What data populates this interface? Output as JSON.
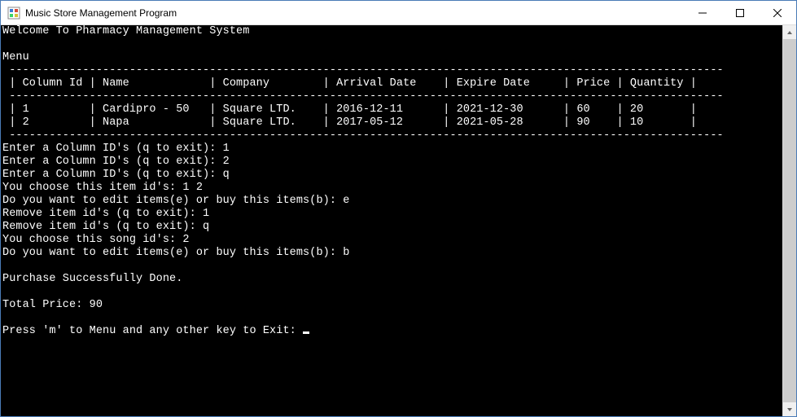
{
  "window": {
    "title": "Music Store Management Program"
  },
  "console": {
    "welcome": "Welcome To Pharmacy Management System",
    "menuLabel": "Menu",
    "columns": [
      "Column Id",
      "Name",
      "Company",
      "Arrival Date",
      "Expire Date",
      "Price",
      "Quantity"
    ],
    "rows": [
      {
        "id": "1",
        "name": "Cardipro - 50",
        "company": "Square LTD.",
        "arrival": "2016-12-11",
        "expire": "2021-12-30",
        "price": "60",
        "qty": "20"
      },
      {
        "id": "2",
        "name": "Napa",
        "company": "Square LTD.",
        "arrival": "2017-05-12",
        "expire": "2021-05-28",
        "price": "90",
        "qty": "10"
      }
    ],
    "prompts": {
      "enterId": "Enter a Column ID's (q to exit): ",
      "youChooseItems": "You choose this item id's: ",
      "editOrBuy": "Do you want to edit items(e) or buy this items(b): ",
      "removeId": "Remove item id's (q to exit): ",
      "youChooseSongs": "You choose this song id's: ",
      "purchaseDone": "Purchase Successfully Done.",
      "totalPriceLabel": "Total Price: ",
      "pressM": "Press 'm' to Menu and any other key to Exit: "
    },
    "inputs": {
      "enter1": "1",
      "enter2": "2",
      "enter3": "q",
      "chosenItems": "1 2",
      "editOrBuy1": "e",
      "remove1": "1",
      "remove2": "q",
      "chosenSongs": "2",
      "editOrBuy2": "b",
      "totalPrice": "90"
    }
  }
}
